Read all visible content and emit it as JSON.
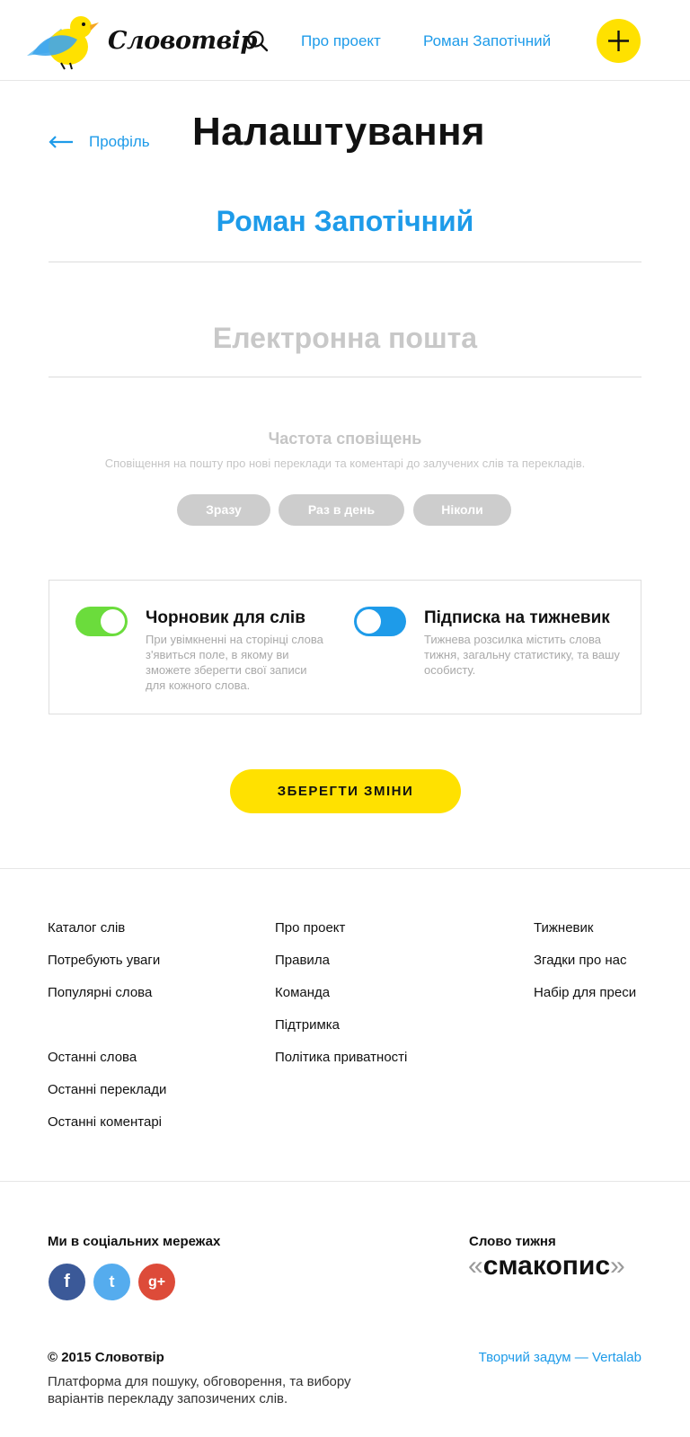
{
  "header": {
    "logo_text": "Словотвір",
    "nav": [
      "Про проект",
      "Роман Запотічний"
    ]
  },
  "settings": {
    "back_label": "Профіль",
    "title": "Налаштування",
    "user_name": "Роман Запотічний",
    "email_placeholder": "Електронна пошта",
    "email_value": "",
    "frequency": {
      "title": "Частота сповіщень",
      "description": "Сповіщення на пошту про нові переклади та коментарі до залучених слів та перекладів.",
      "options": [
        "Зразу",
        "Раз в день",
        "Ніколи"
      ]
    },
    "toggles": [
      {
        "title": "Чорновик для слів",
        "description": "При увімкненні на сторінці слова з'явиться поле, в якому ви зможете зберегти свої записи для кожного слова.",
        "on": true,
        "color": "#6bdc3c"
      },
      {
        "title": "Підписка на тижневик",
        "description": "Тижнева розсилка містить слова тижня, загальну статистику, та вашу особисту.",
        "on": false,
        "color": "#1e9be9"
      }
    ],
    "save_label": "ЗБЕРЕГТИ ЗМІНИ"
  },
  "footer": {
    "col1": [
      "Каталог слів",
      "Потребують уваги",
      "Популярні слова",
      "Останні слова",
      "Останні переклади",
      "Останні коментарі"
    ],
    "col2": [
      "Про проект",
      "Правила",
      "Команда",
      "Підтримка",
      "Політика приватності"
    ],
    "col3": [
      "Тижневик",
      "Згадки про нас",
      "Набір для преси"
    ],
    "social_title": "Ми в соціальних мережах",
    "social": [
      {
        "icon": "facebook-icon",
        "glyph": "f",
        "color": "#3b5998"
      },
      {
        "icon": "twitter-icon",
        "glyph": "t",
        "color": "#55acee"
      },
      {
        "icon": "google-plus-icon",
        "glyph": "g+",
        "color": "#dd4b39"
      }
    ],
    "word_of_week_title": "Слово тижня",
    "word_of_week": "смакопис",
    "copyright": "© 2015 Словотвір",
    "tagline": "Платформа для пошуку, обговорення, та вибору варіантів перекладу запозичених слів.",
    "credit": "Творчий задум — Vertalab"
  },
  "colors": {
    "accent_blue": "#1e9be9",
    "accent_yellow": "#ffe100",
    "toggle_green": "#6bdc3c"
  }
}
